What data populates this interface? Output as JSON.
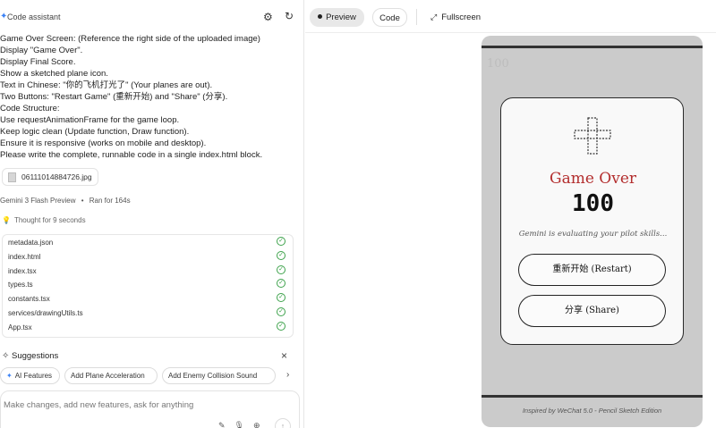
{
  "left_panel": {
    "title": "Code assistant",
    "prompt_lines": [
      "Game Over Screen: (Reference the right side of the uploaded image)",
      "Display \"Game Over\".",
      "Display Final Score.",
      "Show a sketched plane icon.",
      "Text in Chinese: \"你的飞机打光了\" (Your planes are out).",
      "Two Buttons: \"Restart Game\" (重新开始) and \"Share\" (分享).",
      "Code Structure:",
      "Use requestAnimationFrame for the game loop.",
      "Keep logic clean (Update function, Draw function).",
      "Ensure it is responsive (works on mobile and desktop).",
      "Please write the complete, runnable code in a single index.html block."
    ],
    "attachment": "06111014884726.jpg",
    "model": "Gemini 3 Flash Preview",
    "ran_for": "Ran for 164s",
    "thought": "Thought for 9 seconds",
    "files": [
      "metadata.json",
      "index.html",
      "index.tsx",
      "types.ts",
      "constants.tsx",
      "services/drawingUtils.ts",
      "App.tsx"
    ],
    "suggestions_label": "Suggestions",
    "suggestions": [
      "AI Features",
      "Add Plane Acceleration",
      "Add Enemy Collision Sound"
    ],
    "input_placeholder": "Make changes, add new features, ask for anything"
  },
  "right_panel": {
    "tabs": {
      "preview": "Preview",
      "code": "Code",
      "fullscreen": "Fullscreen"
    },
    "background_score": "100",
    "game_over_title": "Game Over",
    "final_score": "100",
    "evaluating_text": "Gemini is evaluating your pilot skills...",
    "restart_button": "重新开始 (Restart)",
    "share_button": "分享 (Share)",
    "footer": "Inspired by WeChat 5.0 - Pencil Sketch Edition"
  },
  "colors": {
    "accent": "#3b82f6",
    "title_red": "#b32e2e",
    "success": "#3fa34d"
  }
}
